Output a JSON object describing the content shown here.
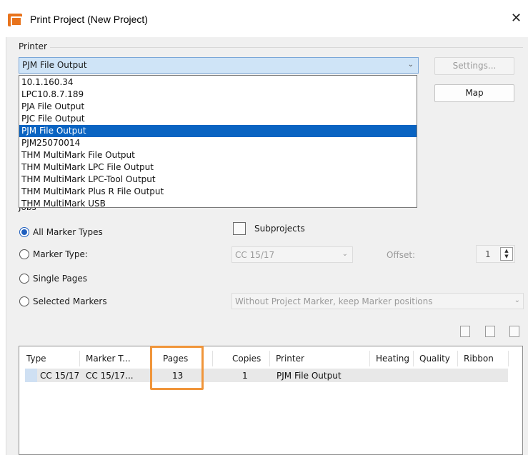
{
  "window": {
    "title": "Print Project (New Project)",
    "close_glyph": "✕",
    "icon": "app-icon"
  },
  "printer": {
    "group_label": "Printer",
    "selected": "PJM File Output",
    "settings_label": "Settings...",
    "map_label": "Map",
    "options": [
      "10.1.160.34",
      "LPC10.8.7.189",
      "PJA File Output",
      "PJC File Output",
      "PJM File Output",
      "PJM25070014",
      "THM MultiMark File Output",
      "THM MultiMark LPC File Output",
      "THM MultiMark LPC-Tool Output",
      "THM MultiMark Plus R File Output",
      "THM MultiMark USB"
    ],
    "selected_index": 4
  },
  "jobs": {
    "group_label": "Jobs",
    "all_marker_types": "All Marker Types",
    "marker_type": "Marker Type:",
    "single_pages": "Single Pages",
    "selected_markers": "Selected Markers",
    "subprojects_label": "Subprojects",
    "marker_type_value": "CC 15/17",
    "offset_label": "Offset:",
    "offset_value": "1",
    "marker_positions_value": "Without Project Marker, keep Marker positions"
  },
  "table": {
    "headers": [
      "Type",
      "Marker T...",
      "Pages",
      "Copies",
      "Printer",
      "Heating",
      "Quality",
      "Ribbon"
    ],
    "rows": [
      [
        "CC 15/17",
        "CC 15/17...",
        "13",
        "1",
        "PJM File Output",
        "",
        "",
        ""
      ]
    ]
  },
  "colors": {
    "accent": "#0a64c2",
    "highlight": "#f0953a",
    "app_icon": "#e8731c"
  }
}
